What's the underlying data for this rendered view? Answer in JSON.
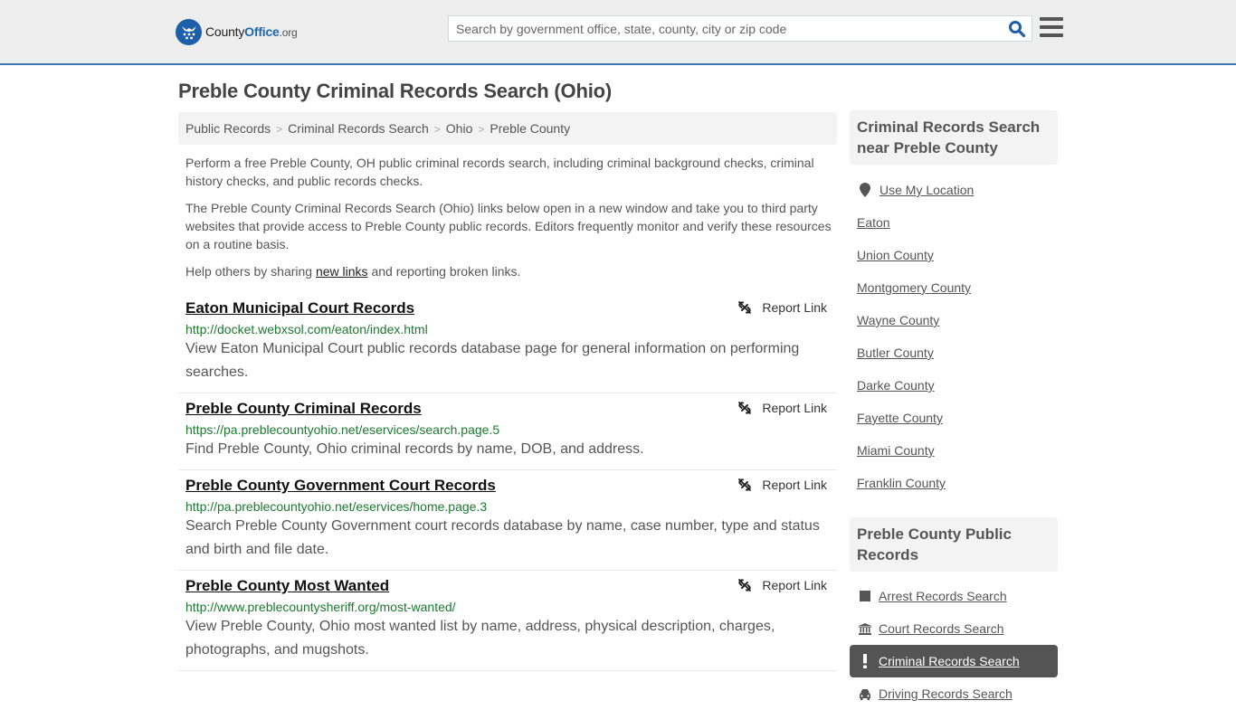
{
  "header": {
    "logo": {
      "part1": "County",
      "part2": "Office",
      "part3": ".org"
    },
    "search_placeholder": "Search by government office, state, county, city or zip code",
    "search_value": "",
    "brand_color": "#1f5fa9",
    "accent_border_color": "#3b79b0"
  },
  "page_title": "Preble County Criminal Records Search (Ohio)",
  "breadcrumb": [
    "Public Records",
    "Criminal Records Search",
    "Ohio",
    "Preble County"
  ],
  "intro": {
    "p1": "Perform a free Preble County, OH public criminal records search, including criminal background checks, criminal history checks, and public records checks.",
    "p2": "The Preble County Criminal Records Search (Ohio) links below open in a new window and take you to third party websites that provide access to Preble County public records. Editors frequently monitor and verify these resources on a routine basis.",
    "p3_before": "Help others by sharing ",
    "p3_link": "new links",
    "p3_after": " and reporting broken links."
  },
  "report_label": "Report Link",
  "results": [
    {
      "title": "Eaton Municipal Court Records",
      "url": "http://docket.webxsol.com/eaton/index.html",
      "description": "View Eaton Municipal Court public records database page for general information on performing searches."
    },
    {
      "title": "Preble County Criminal Records",
      "url": "https://pa.preblecountyohio.net/eservices/search.page.5",
      "description": "Find Preble County, Ohio criminal records by name, DOB, and address."
    },
    {
      "title": "Preble County Government Court Records",
      "url": "http://pa.preblecountyohio.net/eservices/home.page.3",
      "description": "Search Preble County Government court records database by name, case number, type and status and birth and file date."
    },
    {
      "title": "Preble County Most Wanted",
      "url": "http://www.preblecountysheriff.org/most-wanted/",
      "description": "View Preble County, Ohio most wanted list by name, address, physical description, charges, photographs, and mugshots."
    }
  ],
  "sidebar": {
    "nearby_heading": "Criminal Records Search near Preble County",
    "use_location": "Use My Location",
    "nearby": [
      "Eaton",
      "Union County",
      "Montgomery County",
      "Wayne County",
      "Butler County",
      "Darke County",
      "Fayette County",
      "Miami County",
      "Franklin County"
    ],
    "public_records_heading": "Preble County Public Records",
    "public_records": [
      {
        "label": "Arrest Records Search",
        "icon": "square-icon",
        "active": false
      },
      {
        "label": "Court Records Search",
        "icon": "courthouse-icon",
        "active": false
      },
      {
        "label": "Criminal Records Search",
        "icon": "exclamation-icon",
        "active": true
      },
      {
        "label": "Driving Records Search",
        "icon": "car-icon",
        "active": false
      }
    ]
  }
}
